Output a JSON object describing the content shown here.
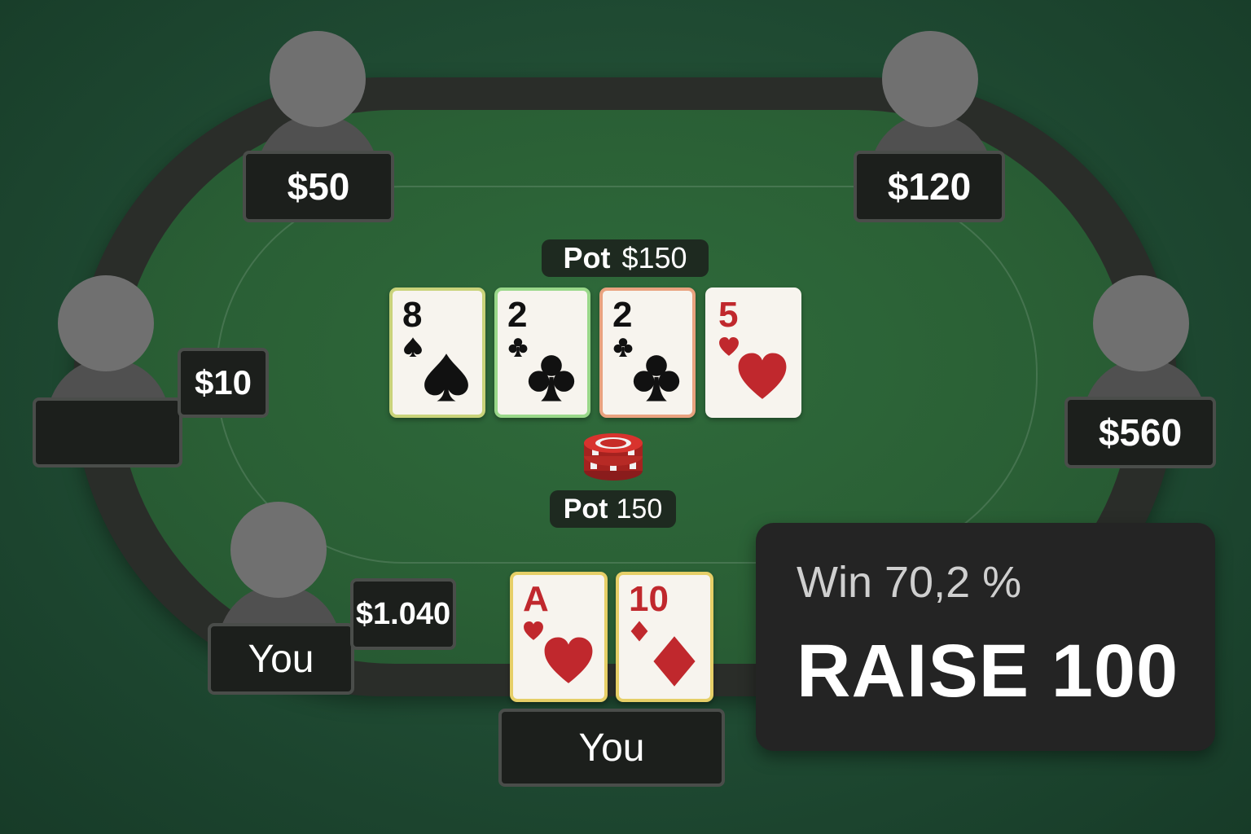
{
  "table": {
    "pot_top_label": "Pot",
    "pot_top_amount": "$150",
    "pot_bottom_label": "Pot",
    "pot_bottom_amount": "150"
  },
  "seats": {
    "top_left": {
      "stack": "$50"
    },
    "top_right": {
      "stack": "$120"
    },
    "left": {
      "stack": "$10",
      "name": ""
    },
    "right": {
      "stack": "$560"
    },
    "bottom_left": {
      "stack": "$1.040",
      "name": "You"
    },
    "hero": {
      "name": "You"
    }
  },
  "board": [
    {
      "rank": "8",
      "suit": "spade",
      "color": "black",
      "border": "#c9d37a"
    },
    {
      "rank": "2",
      "suit": "club",
      "color": "black",
      "border": "#9ad88a"
    },
    {
      "rank": "2",
      "suit": "club",
      "color": "black",
      "border": "#e9a27f"
    },
    {
      "rank": "5",
      "suit": "heart",
      "color": "red",
      "border": "#f7f4ee"
    }
  ],
  "hero_cards": [
    {
      "rank": "A",
      "suit": "heart",
      "color": "red",
      "border": "#e6cf67"
    },
    {
      "rank": "10",
      "suit": "diamond",
      "color": "red",
      "border": "#e6cf67"
    }
  ],
  "advisor": {
    "win_text": "Win 70,2 %",
    "action_text": "RAISE 100"
  },
  "colors": {
    "felt": "#2a5f35",
    "rail": "#2a2d29",
    "suit_red": "#c0282d",
    "suit_black": "#111111"
  },
  "icons": [
    "spade-icon",
    "club-icon",
    "heart-icon",
    "diamond-icon",
    "chip-stack-icon",
    "player-avatar-icon"
  ]
}
